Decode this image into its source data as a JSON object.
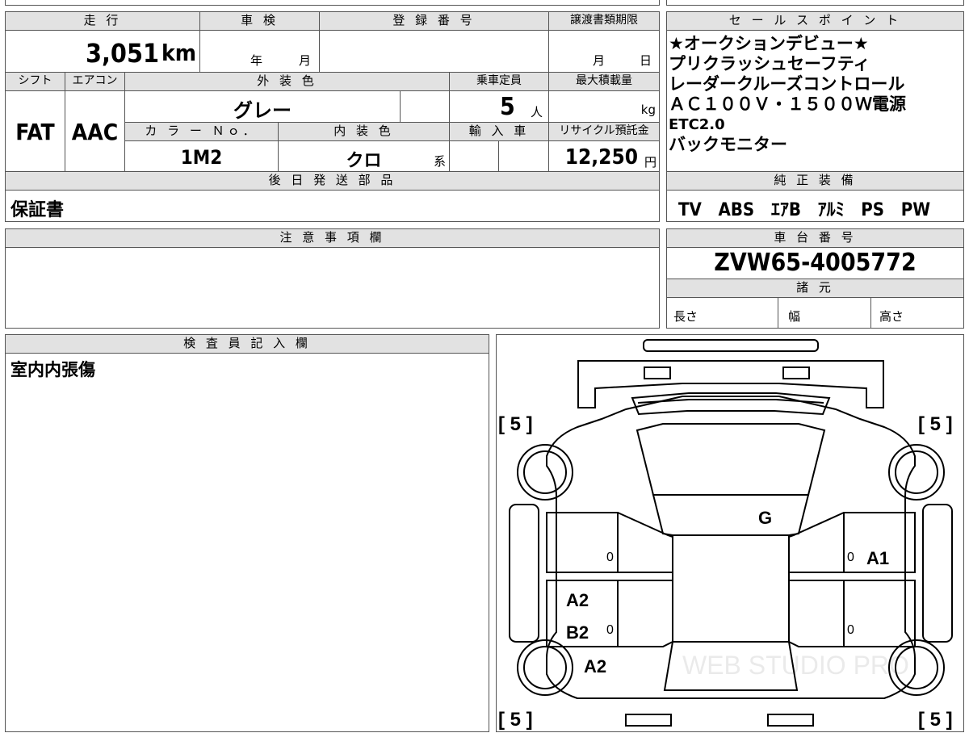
{
  "mileage": {
    "header": "走 行",
    "value": "3,051",
    "unit": "km"
  },
  "inspection": {
    "header": "車 検",
    "year_label": "年",
    "month_label": "月"
  },
  "registration": {
    "header": "登 録 番 号"
  },
  "transfer_deadline": {
    "header": "譲渡書類期限",
    "month_label": "月",
    "day_label": "日"
  },
  "sales_points": {
    "header": "セ ー ル ス ポ イ ン ト",
    "items": [
      "★オークションデビュー★",
      "プリクラッシュセーフティ",
      "レーダークルーズコントロール",
      "ＡＣ１００Ｖ・１５００Ｗ電源",
      "ETC2.0",
      "バックモニター"
    ]
  },
  "shift": {
    "header": "シフト",
    "value": "FAT"
  },
  "aircon": {
    "header": "エアコン",
    "value": "AAC"
  },
  "exterior_color": {
    "header": "外 装 色",
    "value": "グレー"
  },
  "capacity": {
    "header": "乗車定員",
    "value": "5",
    "unit": "人"
  },
  "max_load": {
    "header": "最大積載量",
    "unit": "kg"
  },
  "color_no": {
    "header": "カ ラ ー Ｎｏ．",
    "value": "1M2"
  },
  "interior_color": {
    "header": "内 装 色",
    "value": "クロ",
    "suffix": "系"
  },
  "import": {
    "header": "輸 入 車"
  },
  "recycle": {
    "header": "リサイクル預託金",
    "value": "12,250",
    "unit": "円"
  },
  "later_parts": {
    "header": "後 日 発 送 部 品",
    "value": "保証書"
  },
  "genuine_equipment": {
    "header": "純 正 装 備",
    "items": [
      "TV",
      "ABS",
      "ｴｱB",
      "ｱﾙﾐ",
      "PS",
      "PW"
    ]
  },
  "notes": {
    "header": "注 意 事 項 欄"
  },
  "chassis": {
    "header": "車 台 番 号",
    "value": "ZVW65-4005772"
  },
  "specs": {
    "header": "諸 元",
    "length_label": "長さ",
    "width_label": "幅",
    "height_label": "高さ"
  },
  "inspector": {
    "header": "検 査 員 記 入 欄",
    "note": "室内内張傷"
  },
  "diagram": {
    "tire_left_front": "[ 5 ]",
    "tire_right_front": "[ 5 ]",
    "tire_left_rear": "[ 5 ]",
    "tire_right_rear": "[ 5 ]",
    "glass_mark": "G",
    "right_front_door_mark": "A1",
    "left_rear_door_marks": [
      "A2",
      "B2"
    ],
    "left_rear_fender_mark": "A2",
    "zero": "0",
    "watermark": "WEB STUDIO PRO"
  }
}
